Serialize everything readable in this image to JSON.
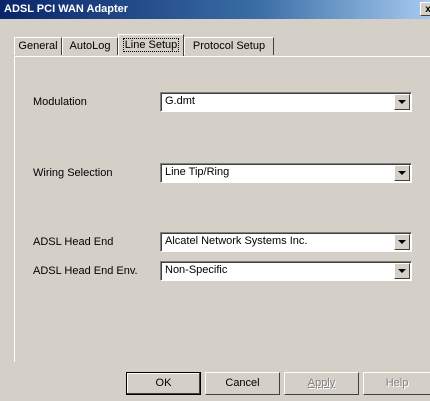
{
  "window": {
    "title": "ADSL PCI WAN Adapter",
    "close_glyph": "x"
  },
  "tabs": [
    {
      "label": "General",
      "active": false
    },
    {
      "label": "AutoLog",
      "active": false
    },
    {
      "label": "Line Setup",
      "active": true
    },
    {
      "label": "Protocol Setup",
      "active": false
    }
  ],
  "fields": {
    "modulation": {
      "label": "Modulation",
      "value": "G.dmt"
    },
    "wiring": {
      "label": "Wiring Selection",
      "value": "Line Tip/Ring"
    },
    "head_end": {
      "label": "ADSL Head End",
      "value": "Alcatel Network Systems Inc."
    },
    "head_end_env": {
      "label": "ADSL Head End Env.",
      "value": "Non-Specific"
    }
  },
  "buttons": {
    "ok": "OK",
    "cancel": "Cancel",
    "apply": "Apply",
    "help": "Help"
  },
  "colors": {
    "dialog_face": "#d4d0c8",
    "title_active": "#0a246a",
    "disabled_text": "#808080"
  }
}
